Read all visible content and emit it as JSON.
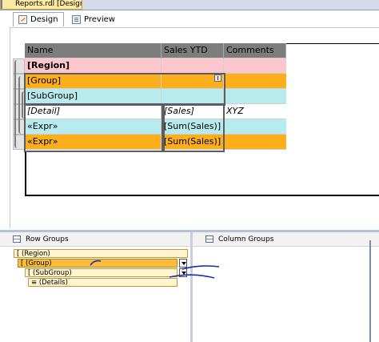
{
  "document_tab": {
    "title": "Reports.rdl [Design]"
  },
  "view_tabs": [
    {
      "label": "Design",
      "icon": "design-icon"
    },
    {
      "label": "Preview",
      "icon": "preview-icon"
    }
  ],
  "tablix": {
    "headers": [
      "Name",
      "Sales YTD",
      "Comments"
    ],
    "rows": [
      {
        "cells": [
          "[Region]",
          "",
          ""
        ]
      },
      {
        "cells": [
          "[Group]",
          "",
          ""
        ]
      },
      {
        "cells": [
          "[SubGroup]",
          "",
          ""
        ]
      },
      {
        "cells": [
          "[Detail]",
          "[Sales]",
          "XYZ"
        ]
      },
      {
        "cells": [
          "«Expr»",
          "[Sum(Sales)]",
          ""
        ]
      },
      {
        "cells": [
          "«Expr»",
          "[Sum(Sales)]",
          ""
        ]
      }
    ]
  },
  "row_groups_pane": {
    "title": "Row Groups",
    "items": [
      {
        "label": "[ (Region)"
      },
      {
        "label": "[ (Group)"
      },
      {
        "label": "[ (SubGroup)"
      },
      {
        "label": "≡ (Details)"
      }
    ]
  },
  "column_groups_pane": {
    "title": "Column Groups"
  },
  "colors": {
    "region": "#fbc6cc",
    "group": "#fdae1d",
    "subgroup": "#b7ebee",
    "header": "#7d7d7d",
    "annotation_ink": "#1a2bb8"
  }
}
